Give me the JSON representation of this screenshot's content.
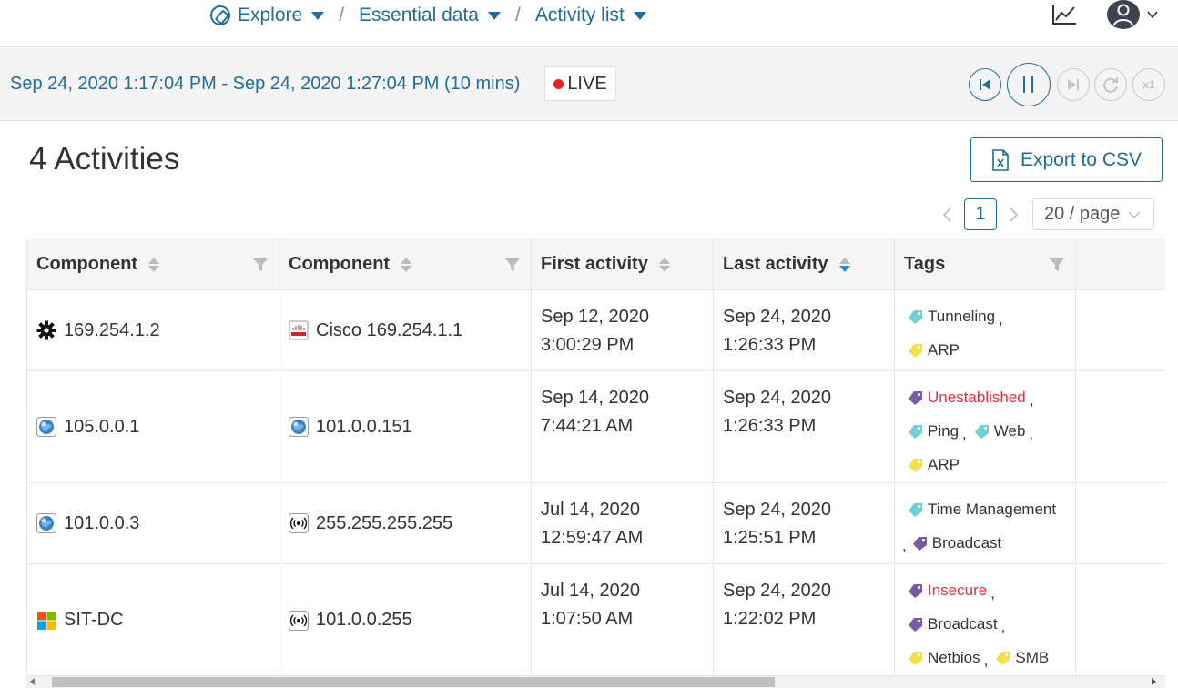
{
  "nav": {
    "crumbs": [
      {
        "label": "Explore"
      },
      {
        "label": "Essential data"
      },
      {
        "label": "Activity list"
      }
    ],
    "separator": "/"
  },
  "timebar": {
    "range": "Sep 24, 2020 1:17:04 PM - Sep 24, 2020 1:27:04 PM  (10 mins)",
    "live_label": "LIVE",
    "speed_label": "x1"
  },
  "header": {
    "title": "4 Activities",
    "export_label": "Export to CSV"
  },
  "pager": {
    "current": "1",
    "page_size": "20 / page"
  },
  "table": {
    "columns": [
      {
        "label": "Component"
      },
      {
        "label": "Component"
      },
      {
        "label": "First activity"
      },
      {
        "label": "Last activity"
      },
      {
        "label": "Tags"
      }
    ],
    "rows": [
      {
        "src": {
          "name": "169.254.1.2",
          "icon": "gear-icon"
        },
        "dst": {
          "name": "Cisco 169.254.1.1",
          "icon": "cisco-icon"
        },
        "first": [
          "Sep 12, 2020",
          "3:00:29 PM"
        ],
        "last": [
          "Sep 24, 2020",
          "1:26:33 PM"
        ],
        "tags": [
          [
            {
              "label": "Tunneling",
              "color": "#74cfd3",
              "red": false,
              "comma": true
            }
          ],
          [
            {
              "label": "ARP",
              "color": "#f3e04f",
              "red": false,
              "comma": false
            }
          ]
        ]
      },
      {
        "src": {
          "name": "105.0.0.1",
          "icon": "globe-icon"
        },
        "dst": {
          "name": "101.0.0.151",
          "icon": "globe-icon"
        },
        "first": [
          "Sep 14, 2020",
          "7:44:21 AM"
        ],
        "last": [
          "Sep 24, 2020",
          "1:26:33 PM"
        ],
        "tags": [
          [
            {
              "label": "Unestablished",
              "color": "#7a5aa0",
              "red": true,
              "comma": true
            }
          ],
          [
            {
              "label": "Ping",
              "color": "#74cfd3",
              "red": false,
              "comma": true
            },
            {
              "label": "Web",
              "color": "#74cfd3",
              "red": false,
              "comma": true
            }
          ],
          [
            {
              "label": "ARP",
              "color": "#f3e04f",
              "red": false,
              "comma": false
            }
          ]
        ]
      },
      {
        "src": {
          "name": "101.0.0.3",
          "icon": "globe-icon"
        },
        "dst": {
          "name": "255.255.255.255",
          "icon": "broadcast-icon"
        },
        "first": [
          "Jul 14, 2020",
          "12:59:47 AM"
        ],
        "last": [
          "Sep 24, 2020",
          "1:25:51 PM"
        ],
        "tags": [
          [
            {
              "label": "Time Management",
              "color": "#74cfd3",
              "red": false,
              "comma": false
            }
          ],
          [
            {
              "label": "Broadcast",
              "color": "#7a5aa0",
              "red": false,
              "comma": false,
              "lead_comma": true
            }
          ]
        ]
      },
      {
        "src": {
          "name": "SIT-DC",
          "icon": "windows-icon"
        },
        "dst": {
          "name": "101.0.0.255",
          "icon": "broadcast-icon"
        },
        "first": [
          "Jul 14, 2020",
          "1:07:50 AM"
        ],
        "last": [
          "Sep 24, 2020",
          "1:22:02 PM"
        ],
        "tags": [
          [
            {
              "label": "Insecure",
              "color": "#7a5aa0",
              "red": true,
              "comma": true
            }
          ],
          [
            {
              "label": "Broadcast",
              "color": "#7a5aa0",
              "red": false,
              "comma": true
            }
          ],
          [
            {
              "label": "Netbios",
              "color": "#f3e04f",
              "red": false,
              "comma": true
            },
            {
              "label": "SMB",
              "color": "#f3e04f",
              "red": false,
              "comma": false
            }
          ]
        ]
      }
    ]
  },
  "colors": {
    "accent": "#1f6d98",
    "live_dot": "#e02424",
    "tag_red_text": "#d9363e",
    "sort_active": "#1f8fe0"
  }
}
